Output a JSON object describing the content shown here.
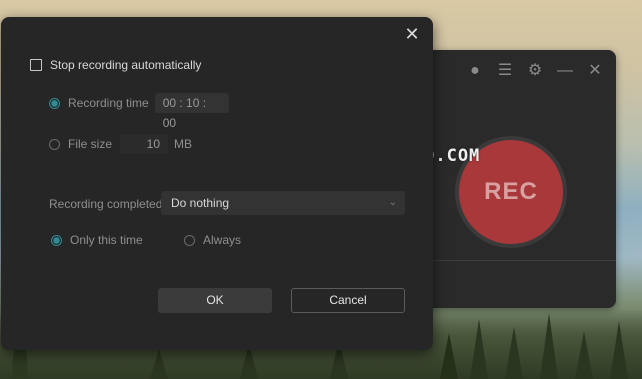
{
  "background_app": {
    "rec_label": "REC",
    "icons": [
      "user-icon",
      "list-icon",
      "gear-icon",
      "minimize-icon",
      "close-icon"
    ]
  },
  "watermark": "COMPUTERWD.COM",
  "dialog": {
    "stop_auto_label": "Stop recording automatically",
    "recording_time_label": "Recording time",
    "recording_time_value": "00 : 10 : 00",
    "file_size_label": "File size",
    "file_size_value": "10",
    "file_size_unit": "MB",
    "recording_completed_label": "Recording completed",
    "recording_completed_value": "Do nothing",
    "only_this_time_label": "Only this time",
    "always_label": "Always",
    "ok_label": "OK",
    "cancel_label": "Cancel"
  },
  "colors": {
    "accent": "#2f8c94",
    "dialog_bg": "#262627",
    "rec_red": "#a8383a"
  }
}
